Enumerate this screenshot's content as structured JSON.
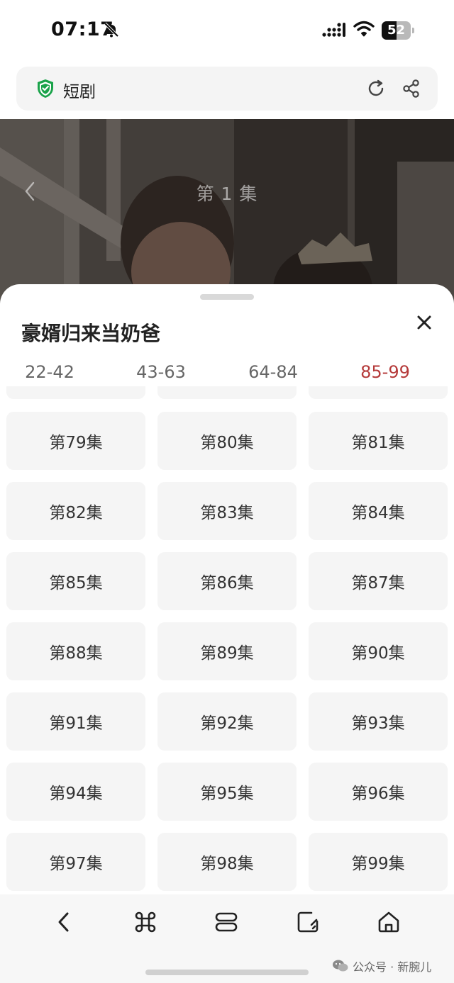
{
  "status_bar": {
    "time": "07:17",
    "battery_level": "52",
    "battery_fraction": 0.52
  },
  "address_bar": {
    "title": "短剧",
    "shield_color": "#1aa34a"
  },
  "video": {
    "episode_title": "第 1 集"
  },
  "sheet": {
    "title": "豪婿归来当奶爸",
    "range_tabs": [
      "22-42",
      "43-63",
      "64-84",
      "85-99"
    ],
    "active_tab_color": "#b53a3a",
    "episodes": [
      "第79集",
      "第80集",
      "第81集",
      "第82集",
      "第83集",
      "第84集",
      "第85集",
      "第86集",
      "第87集",
      "第88集",
      "第89集",
      "第90集",
      "第91集",
      "第92集",
      "第93集",
      "第94集",
      "第95集",
      "第96集",
      "第97集",
      "第98集",
      "第99集"
    ]
  },
  "toolbar": {
    "icons": [
      "back-icon",
      "command-icon",
      "tabs-icon",
      "edit-icon",
      "home-icon"
    ]
  },
  "watermark": {
    "text": "公众号 · 新腕儿"
  }
}
